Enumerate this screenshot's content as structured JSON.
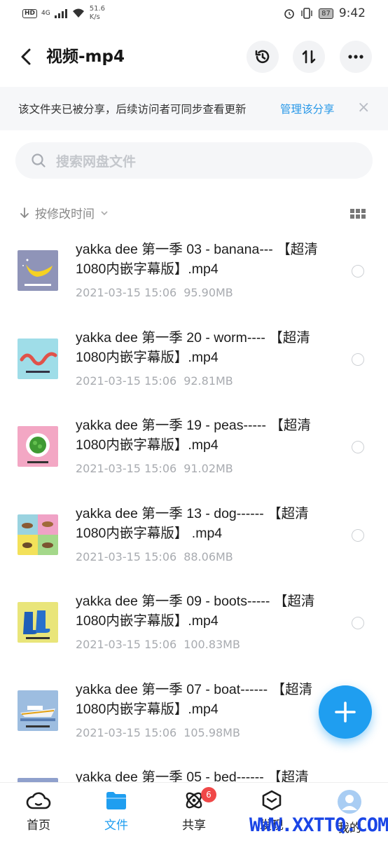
{
  "status_bar": {
    "hd": "HD",
    "signal": "4G",
    "speed_value": "51.6",
    "speed_unit": "K/s",
    "battery": "87",
    "time": "9:42"
  },
  "header": {
    "title": "视频-mp4",
    "icons": [
      "back-arrow-icon",
      "history-icon",
      "transfer-icon",
      "more-icon"
    ]
  },
  "share_banner": {
    "text": "该文件夹已被分享，后续访问者可同步查看更新",
    "link": "管理该分享",
    "close": "×"
  },
  "search": {
    "placeholder": "搜索网盘文件"
  },
  "sort": {
    "label": "按修改时间"
  },
  "files": [
    {
      "name": "yakka dee 第一季 03 - banana--- 【超清1080内嵌字幕版】.mp4",
      "date": "2021-03-15  15:06",
      "size": "95.90MB",
      "thumb": "banana"
    },
    {
      "name": "yakka dee 第一季 20 - worm---- 【超清1080内嵌字幕版】.mp4",
      "date": "2021-03-15  15:06",
      "size": "92.81MB",
      "thumb": "worm"
    },
    {
      "name": "yakka dee 第一季 19 - peas----- 【超清1080内嵌字幕版】.mp4",
      "date": "2021-03-15  15:06",
      "size": "91.02MB",
      "thumb": "peas"
    },
    {
      "name": "yakka dee 第一季 13 - dog------ 【超清1080内嵌字幕版】 .mp4",
      "date": "2021-03-15  15:06",
      "size": "88.06MB",
      "thumb": "dog"
    },
    {
      "name": "yakka dee 第一季 09 - boots----- 【超清1080内嵌字幕版】.mp4",
      "date": "2021-03-15  15:06",
      "size": "100.83MB",
      "thumb": "boots"
    },
    {
      "name": "yakka dee 第一季 07 - boat------ 【超清1080内嵌字幕版】.mp4",
      "date": "2021-03-15  15:06",
      "size": "105.98MB",
      "thumb": "boat"
    },
    {
      "name": "yakka dee 第一季 05 - bed------ 【超清",
      "date": "",
      "size": "",
      "thumb": "bed"
    }
  ],
  "bottom_nav": {
    "items": [
      {
        "label": "首页",
        "icon": "home-cloud-icon"
      },
      {
        "label": "文件",
        "icon": "folder-icon"
      },
      {
        "label": "共享",
        "icon": "share-atom-icon",
        "badge": "6"
      },
      {
        "label": "发现",
        "icon": "discover-cube-icon"
      },
      {
        "label": "我的",
        "icon": "avatar-icon"
      }
    ]
  },
  "watermark": "WWW.XXTTQ.COM",
  "colors": {
    "accent": "#1f9ef0",
    "link": "#2898e8",
    "badge": "#f04848",
    "meta_text": "#a8abb0"
  }
}
